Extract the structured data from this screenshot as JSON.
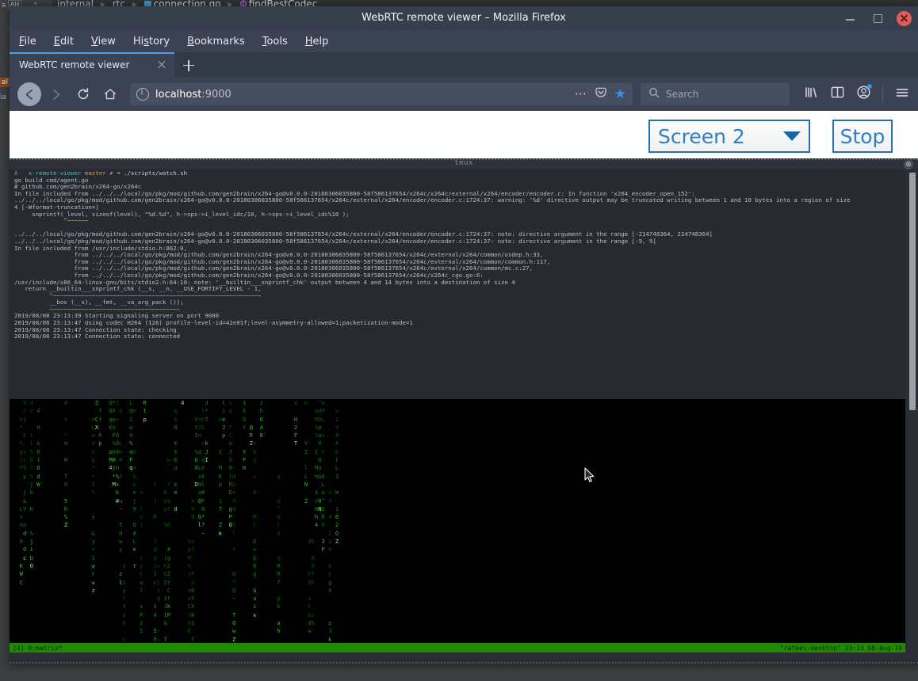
{
  "ide_background": {
    "breadcrumb": {
      "parts": [
        "internal",
        "rtc",
        "connection.go",
        "findBestCodec"
      ],
      "separator": "▸"
    },
    "tab_strip": {
      "left_label": "a",
      "boxed_label": "Ahl",
      "modified_label": "_*"
    },
    "side_tags": {
      "highlighted": "al",
      "secondary": "ia"
    }
  },
  "window": {
    "title": "WebRTC remote viewer – Mozilla Firefox",
    "controls": {
      "minimize": "minimize-button",
      "maximize": "maximize-button",
      "close": "close-button"
    }
  },
  "menubar": {
    "items": [
      {
        "label": "File",
        "accel": "F"
      },
      {
        "label": "Edit",
        "accel": "E"
      },
      {
        "label": "View",
        "accel": "V"
      },
      {
        "label": "History",
        "accel": "s"
      },
      {
        "label": "Bookmarks",
        "accel": "B"
      },
      {
        "label": "Tools",
        "accel": "T"
      },
      {
        "label": "Help",
        "accel": "H"
      }
    ]
  },
  "tabbar": {
    "tabs": [
      {
        "title": "WebRTC remote viewer",
        "active": true
      }
    ],
    "new_tab_label": "+"
  },
  "navbar": {
    "back_icon": "back-arrow-icon",
    "forward_icon": "forward-arrow-icon",
    "reload_icon": "reload-icon",
    "home_icon": "home-icon",
    "url": {
      "host": "localhost",
      "port": ":9000",
      "full": "localhost:9000"
    },
    "page_actions": [
      "ellipsis-icon",
      "pocket-icon",
      "bookmark-star-icon"
    ],
    "search": {
      "placeholder": "Search",
      "icon": "search-icon"
    },
    "toolbar_icons": [
      "library-icon",
      "sidebar-icon",
      "account-icon",
      "menu-icon"
    ]
  },
  "page": {
    "screen_select": {
      "value": "Screen 2",
      "caret": "chevron-down-icon"
    },
    "stop_button": {
      "label": "Stop"
    },
    "accent_color": "#2a6ea8",
    "link_color": "#2f7fc4"
  },
  "viewer": {
    "tmux_window_label": "tmux",
    "terminal_lines": [
      "λ   x-remote-viewer master ✗ ➜ ./scripts/watch.sh",
      "go build cmd/agent.go",
      "# github.com/gen2brain/x264-go/x264c",
      "In file included from ../../../local/go/pkg/mod/github.com/gen2brain/x264-go@v0.0.0-20180306035800-58f586137654/x264c/x264c/external/x264/encoder/encoder.c: In function 'x264_encoder_open_152':",
      "../../../local/go/pkg/mod/github.com/gen2brain/x264-go@v0.0.0-20180306035800-58f586137654/x264c/external/x264/encoder/encoder.c:1724:37: warning: '%d' directive output may be truncated writing between 1 and 10 bytes into a region of size",
      "4 [-Wformat-truncation=]",
      "     snprintf( level, sizeof(level), \"%d.%d\", h->sps->i_level_idc/10, h->sps->i_level_idc%10 );",
      "              ^~~~~~~",
      "",
      "../../../local/go/pkg/mod/github.com/gen2brain/x264-go@v0.0.0-20180306035800-58f586137654/x264c/external/x264/encoder/encoder.c:1724:37: note: directive argument in the range [-214748364, 214748364]",
      "../../../local/go/pkg/mod/github.com/gen2brain/x264-go@v0.0.0-20180306035800-58f586137654/x264c/external/x264/encoder/encoder.c:1724:37: note: directive argument in the range [-9, 9]",
      "In file included from /usr/include/stdio.h:862:0,",
      "                 from ../../../local/go/pkg/mod/github.com/gen2brain/x264-go@v0.0.0-20180306035800-58f586137654/x264c/external/x264/common/osdep.h:33,",
      "                 from ../../../local/go/pkg/mod/github.com/gen2brain/x264-go@v0.0.0-20180306035800-58f586137654/x264c/external/x264/common/common.h:117,",
      "                 from ../../../local/go/pkg/mod/github.com/gen2brain/x264-go@v0.0.0-20180306035800-58f586137654/x264c/external/x264/common/mc.c:27,",
      "                 from ../../../local/go/pkg/mod/github.com/gen2brain/x264-go@v0.0.0-20180306035800-58f586137654/x264c/x264c_cgo.go:6:",
      "/usr/include/x86_64-linux-gnu/bits/stdio2.h:64:10: note: '__builtin___snprintf_chk' output between 4 and 14 bytes into a destination of size 4",
      "   return __builtin___snprintf_chk (__s, __n, __USE_FORTIFY_LEVEL - 1,",
      "          ^~~~~~~~~~~~~~~~~~~~~~~~~~~~~~~~~~~~~~~~~~~~~~~~~~~~~~~~~~~~",
      "          __bos (__s), __fmt, __va_arg_pack ());",
      "          ~~~~~~~~~~~~~~~~~~~~~~~~~~~~~~~~~~~~~",
      "2019/08/08 23:13:39 Starting signaling server on port 9000",
      "2019/08/08 23:13:47 Using codec H264 (126) profile-level-id=42e01f;level-asymmetry-allowed=1;packetization-mode=1",
      "2019/08/08 23:13:47 Connection state: checking",
      "2019/08/08 23:13:47 Connection state: connected"
    ],
    "matrix_charset": "abcdefghijklmnopqrstuvwxyzABCDEFGHIJKLMNOPQRSTUVWXYZ0123456789@#$%&*^~",
    "matrix_columns": 96,
    "matrix_rows": 30,
    "status_bar": {
      "left": "[4] 0:matrix*",
      "right": "\"rafael-desktop\" 23:13 08-Aug-19",
      "bg_color": "#1f8a00"
    },
    "close_badge": "⊗"
  }
}
